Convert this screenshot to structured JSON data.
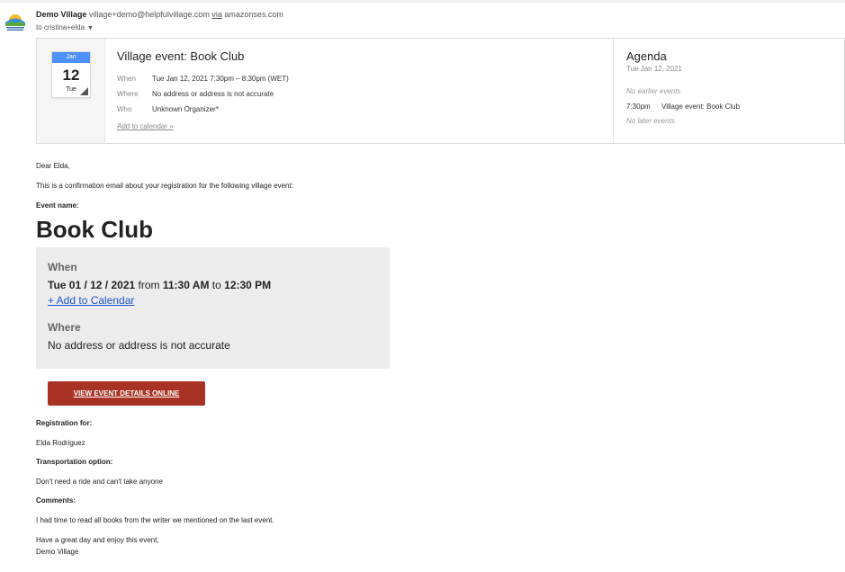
{
  "header": {
    "sender_name": "Demo Village",
    "sender_email": "village+demo@helpfulvillage.com",
    "via_label": "via",
    "via_domain": "amazonses.com",
    "to_line": "to cristina+elda",
    "avatar_icon": "village-logo-icon"
  },
  "invite": {
    "calendar": {
      "month": "Jan",
      "day": "12",
      "weekday": "Tue"
    },
    "title": "Village event: Book Club",
    "when_label": "When",
    "when_value": "Tue Jan 12, 2021 7:30pm – 8:30pm (WET)",
    "where_label": "Where",
    "where_value": "No address or address is not accurate",
    "who_label": "Who",
    "who_value": "Unknown Organizer*",
    "add_to_calendar": "Add to calendar »"
  },
  "agenda": {
    "title": "Agenda",
    "date": "Tue Jan 12, 2021",
    "no_earlier": "No earlier events",
    "item_time": "7:30pm",
    "item_title": "Village event: Book Club",
    "no_later": "No later events"
  },
  "body": {
    "greeting": "Dear Elda,",
    "intro": "This is a confirmation email about your registration for the following village event:",
    "event_name_label": "Event name:",
    "event_name": "Book Club",
    "when_header": "When",
    "date": "Tue 01 / 12 / 2021",
    "from_word": "from",
    "start_time": "11:30 AM",
    "to_word": "to",
    "end_time": "12:30 PM",
    "add_calendar_link": "+ Add to Calendar",
    "where_header": "Where",
    "where_value": "No address or address is not accurate",
    "cta_button": "VIEW EVENT DETAILS ONLINE",
    "registration_label": "Registration for:",
    "registration_value": "Elda Rodriguez",
    "transport_label": "Transportation option:",
    "transport_value": "Don't need a ride and can't take anyone",
    "comments_label": "Comments:",
    "comments_value": "I had time to read all books from the writer we mentioned on the last event.",
    "closing": "Have a great day and enjoy this event,",
    "signature": "Demo Village"
  },
  "colors": {
    "accent_blue": "#4d90fe",
    "link_blue": "#1a55c9",
    "button_red": "#a83325",
    "box_gray": "#ececec"
  }
}
